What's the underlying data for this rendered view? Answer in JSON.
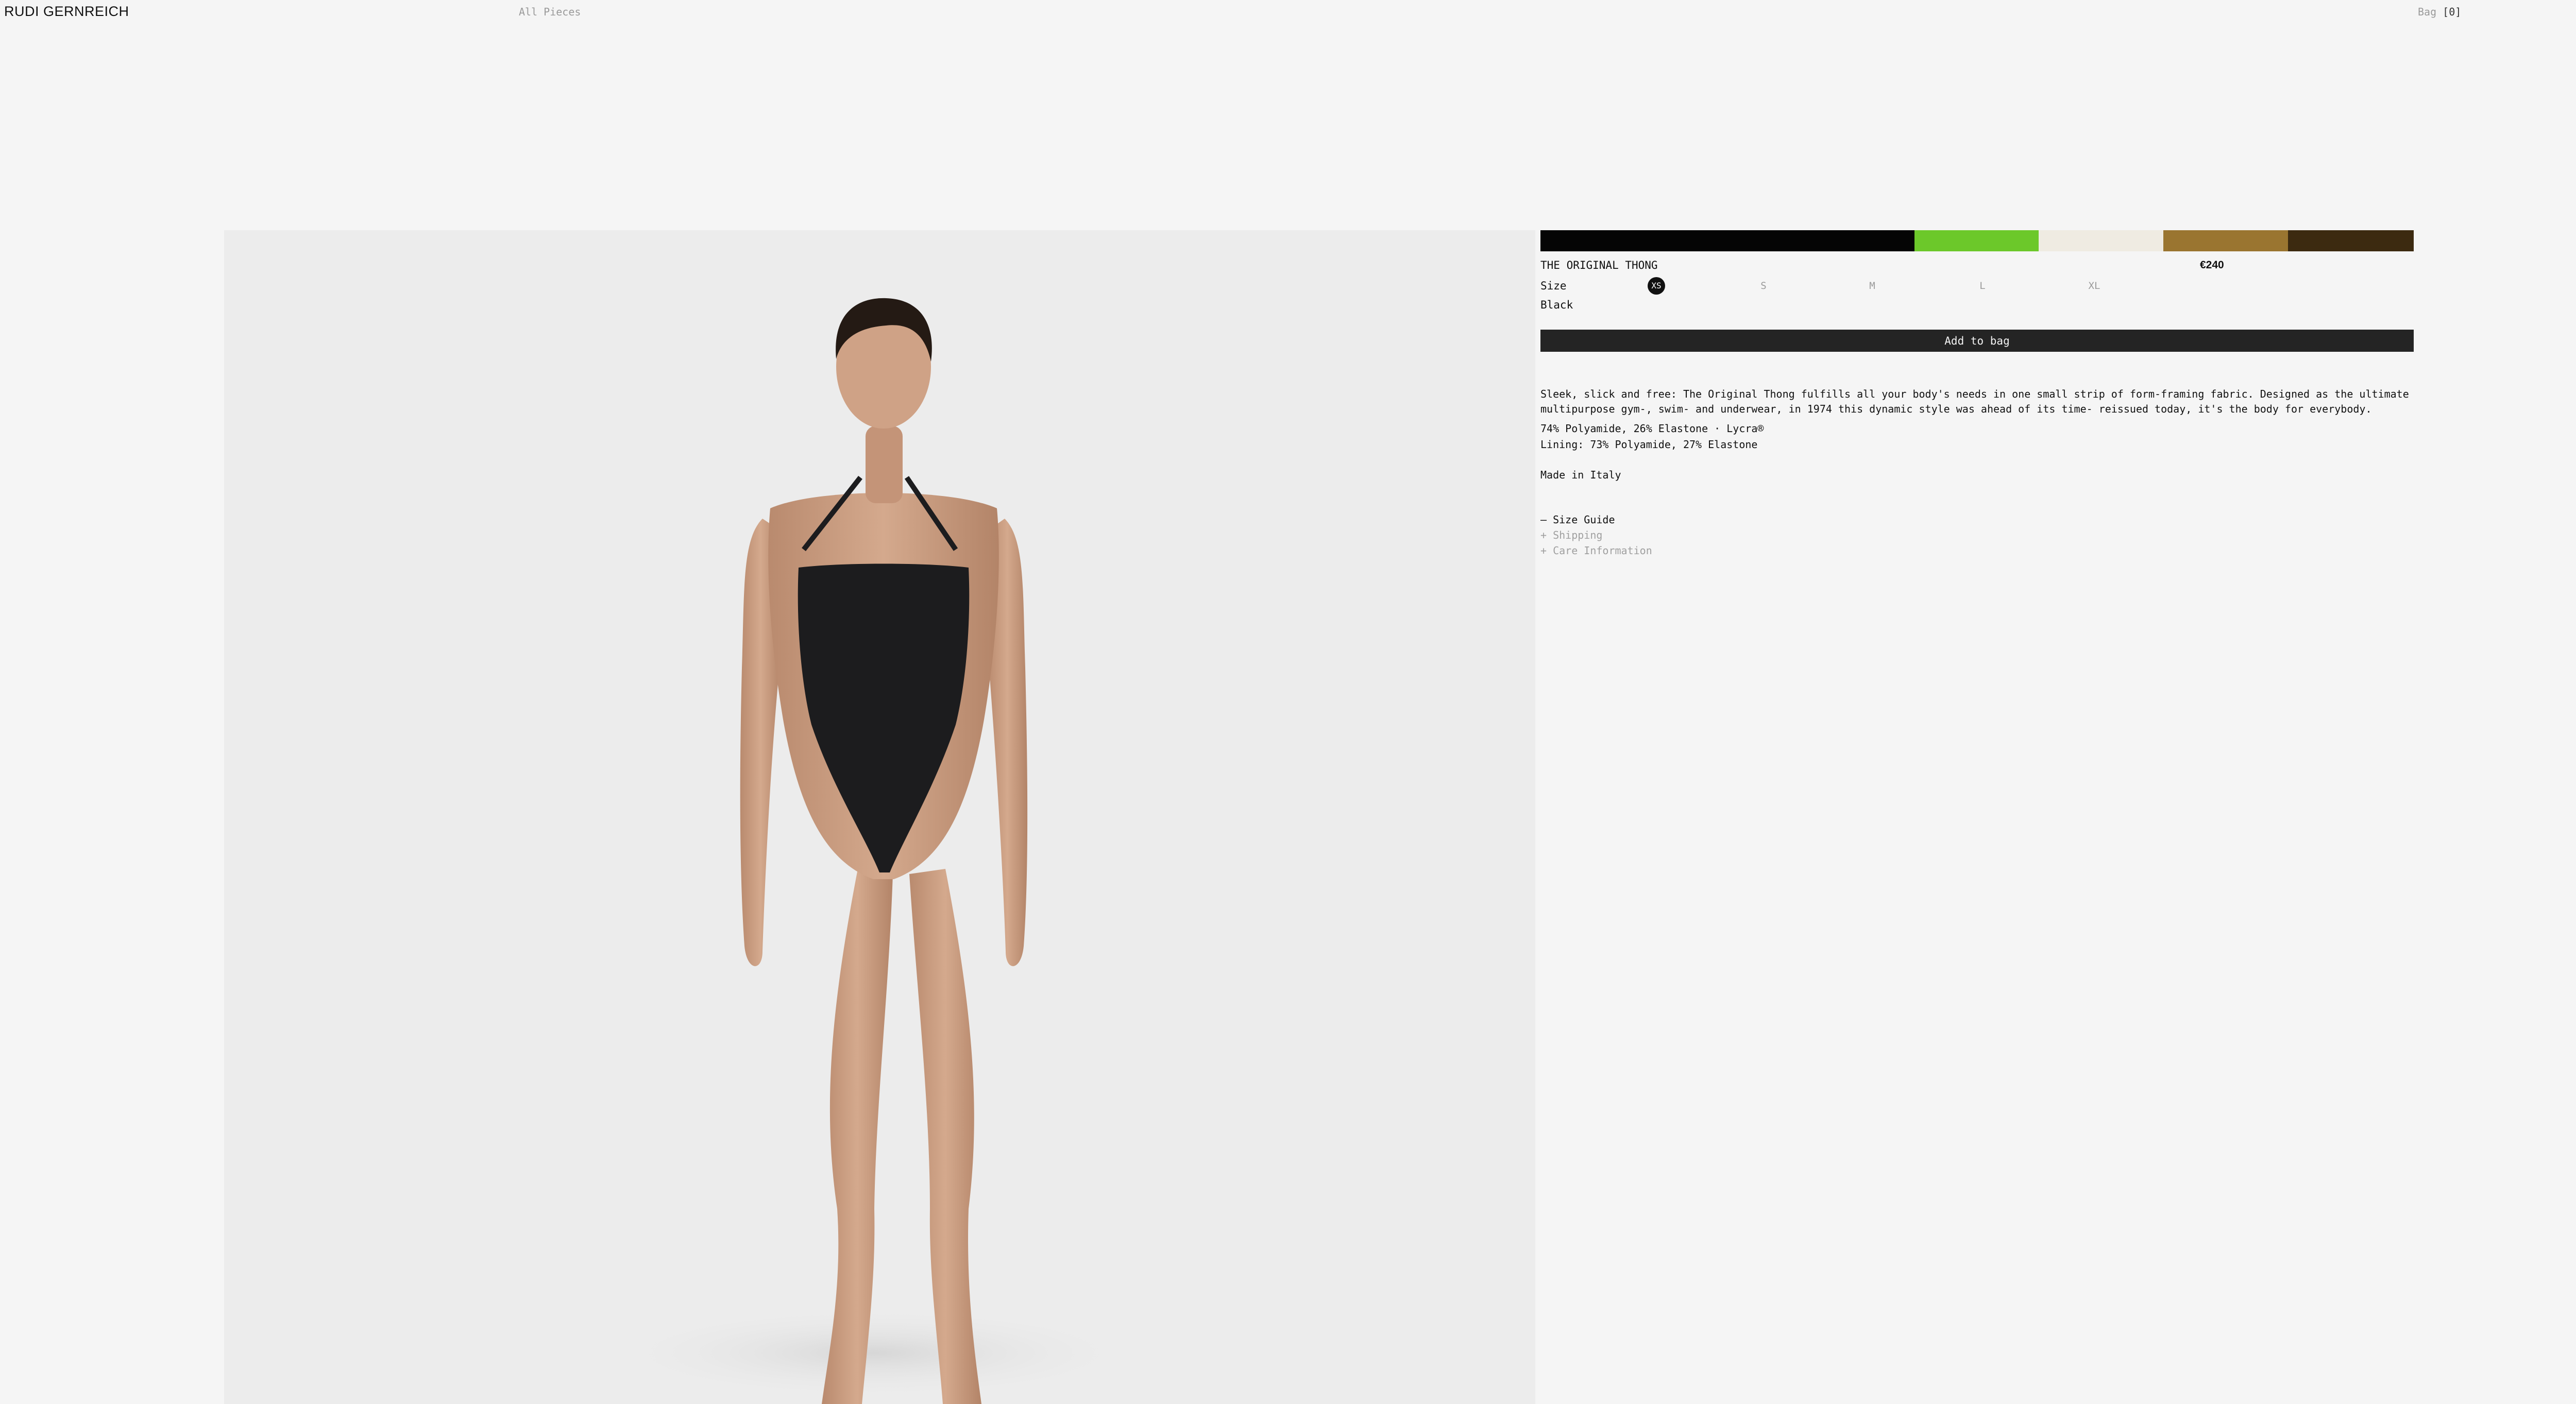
{
  "header": {
    "brand": "RUDI GERNREICH",
    "nav_all": "All Pieces",
    "bag_label": "Bag",
    "bag_count": "[0]"
  },
  "product": {
    "title": "THE ORIGINAL THONG",
    "price": "€240",
    "size_label": "Size",
    "sizes": [
      "XS",
      "S",
      "M",
      "L",
      "XL"
    ],
    "selected_size": "XS",
    "color_name": "Black",
    "swatches": [
      {
        "name": "black",
        "color": "#050505"
      },
      {
        "name": "green",
        "color": "#6cc82a"
      },
      {
        "name": "cream",
        "color": "#efebe2"
      },
      {
        "name": "tan",
        "color": "#9a7530"
      },
      {
        "name": "brown",
        "color": "#3c2a10"
      }
    ],
    "add_to_bag": "Add to bag",
    "description": "Sleek, slick and free: The Original Thong fulfills all your body's needs in one small strip of form-framing fabric. Designed as the ultimate multipurpose gym-, swim- and underwear, in 1974 this dynamic style was ahead of its time- reissued today, it's the body for everybody.",
    "composition": "74% Polyamide, 26% Elastone · Lycra®",
    "lining": "Lining: 73% Polyamide, 27% Elastone",
    "made_in": "Made in Italy",
    "accordion": [
      {
        "label": "– Size Guide",
        "state": "open"
      },
      {
        "label": "+ Shipping",
        "state": "closed"
      },
      {
        "label": "+ Care Information",
        "state": "closed"
      }
    ]
  },
  "colors": {
    "background": "#f5f5f5",
    "image_background": "#ececec",
    "button": "#242424",
    "muted_text": "#9a9a9a"
  }
}
